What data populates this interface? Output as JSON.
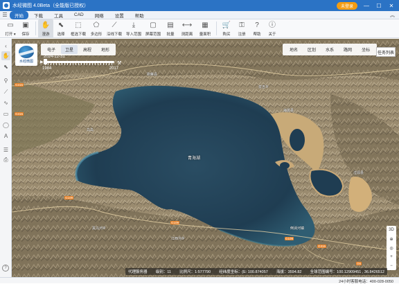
{
  "window": {
    "title": "水经微图 4.0Beta（全能版已授权）",
    "login_label": "未登录",
    "minimize": "—",
    "maximize": "☐",
    "close": "✕"
  },
  "menu": {
    "items": [
      "开始",
      "下载",
      "工具",
      "CAD",
      "网络",
      "设置",
      "帮助"
    ],
    "collapse_icon": "︽"
  },
  "toolbar": {
    "items": [
      {
        "label": "打开 ▾",
        "icon": "open-icon",
        "glyph": "▭"
      },
      {
        "label": "保存",
        "icon": "save-icon",
        "glyph": "▣"
      },
      {
        "label": "漫游",
        "icon": "hand-icon",
        "glyph": "✋"
      },
      {
        "label": "选择",
        "icon": "select-icon",
        "glyph": "⬉"
      },
      {
        "label": "框选下载",
        "icon": "box-download-icon",
        "glyph": "⬚"
      },
      {
        "label": "多边形",
        "icon": "polygon-icon",
        "glyph": "⬠"
      },
      {
        "label": "沿线下载",
        "icon": "line-download-icon",
        "glyph": "⟋"
      },
      {
        "label": "导入范围",
        "icon": "import-range-icon",
        "glyph": "⤓"
      },
      {
        "label": "屏幕范围",
        "icon": "screen-range-icon",
        "glyph": "▢"
      },
      {
        "label": "批量",
        "icon": "batch-icon",
        "glyph": "▤"
      },
      {
        "label": "测距离",
        "icon": "measure-distance-icon",
        "glyph": "⟷"
      },
      {
        "label": "量面积",
        "icon": "measure-area-icon",
        "glyph": "▦"
      },
      {
        "label": "购买",
        "icon": "cart-icon",
        "glyph": "🛒"
      },
      {
        "label": "注册",
        "icon": "register-icon",
        "glyph": "⚿"
      },
      {
        "label": "帮助",
        "icon": "help-icon",
        "glyph": "?"
      },
      {
        "label": "关于",
        "icon": "about-icon",
        "glyph": "ⓘ"
      }
    ]
  },
  "map": {
    "layer_tabs": [
      "电子",
      "卫星",
      "高程",
      "地形"
    ],
    "active_layer": "卫星",
    "logo_text": "水经微图",
    "timeline": {
      "current": "2024-12-31",
      "start": "1984",
      "end": "2017"
    },
    "view_tabs": [
      "地名",
      "区划",
      "水系",
      "路网",
      "坐标"
    ],
    "task_list_label": "任务列表",
    "lake_label": "青海湖",
    "zoom_controls": [
      "3D",
      "⊕",
      "◎",
      "+",
      "−"
    ],
    "road_badges": [
      "G315",
      "G315",
      "G109",
      "G109",
      "G109",
      "G315",
      "G6"
    ]
  },
  "status": {
    "provider": "代理服务器",
    "level_label": "级别：",
    "level": "11",
    "scale_label": "比例尺：",
    "scale": "1:577790",
    "coord_label": "经纬度坐标：",
    "coord": "(E: 100.874057",
    "elev_label": "海拔：",
    "elev": "3594.82",
    "lonlat_label": "全球范围编号：",
    "lonlat": "100.12909451 , 36.8426512"
  },
  "footer": {
    "hotline": "24小时客服电话：400-028-0050"
  },
  "colors": {
    "title_blue": "#2b73c5",
    "lake_deep": "#1d3b4f",
    "land": "#8c7c63"
  }
}
